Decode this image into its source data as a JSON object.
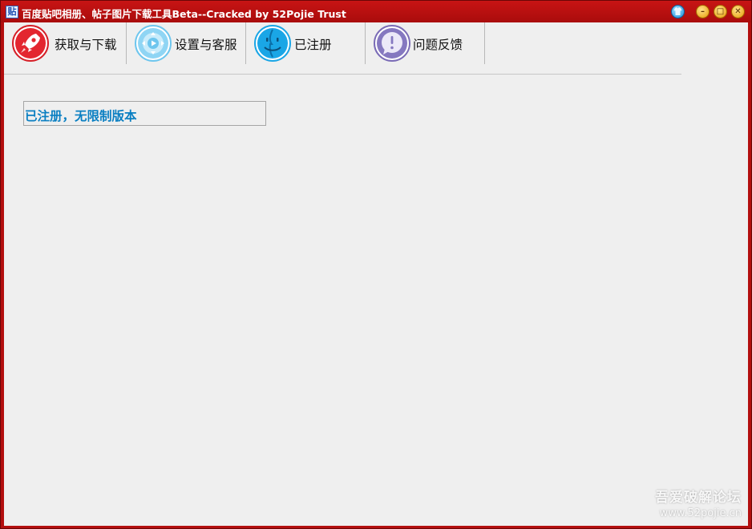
{
  "window": {
    "title": "百度贴吧相册、帖子图片下载工具Beta--Cracked by 52Pojie Trust",
    "app_icon_glyph": "贴",
    "controls": {
      "skin_icon": "shirt-icon",
      "minimize_glyph": "–",
      "maximize_glyph": "□",
      "close_glyph": "✕"
    }
  },
  "toolbar": {
    "items": [
      {
        "label": "获取与下载",
        "icon": "rocket-icon",
        "color": "#e3262f"
      },
      {
        "label": "设置与客服",
        "icon": "gamepad-icon",
        "color": "#6ec6ee"
      },
      {
        "label": "已注册",
        "icon": "finder-face-icon",
        "color": "#1aa6e6"
      },
      {
        "label": "问题反馈",
        "icon": "feedback-bubble-icon",
        "color": "#7a6bb6"
      }
    ]
  },
  "status": {
    "text": "已注册，无限制版本",
    "color": "#0a7fc2"
  },
  "watermark": {
    "line1": "吾爱破解论坛",
    "line2": "www.52pojie.cn"
  },
  "theme": {
    "title_bar": "#b30f0f",
    "client_bg": "#efefef"
  }
}
